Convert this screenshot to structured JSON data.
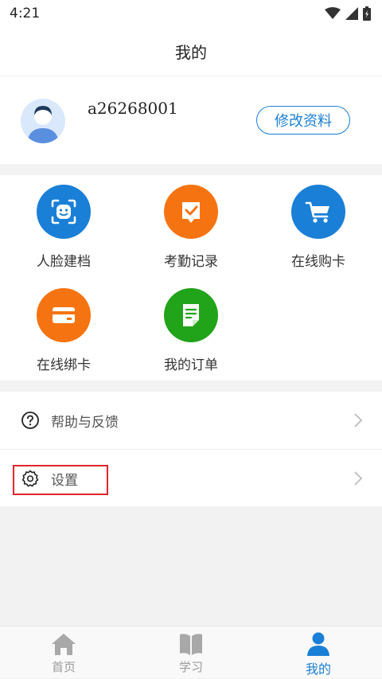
{
  "status": {
    "time": "4:21",
    "wifi_icon": "wifi-icon",
    "signal_icon": "signal-icon",
    "battery_icon": "battery-icon"
  },
  "header": {
    "title": "我的"
  },
  "profile": {
    "username": "a26268001",
    "edit_label": "修改资料",
    "avatar_icon": "avatar-icon"
  },
  "grid": {
    "items": [
      {
        "label": "人脸建档",
        "icon": "face-scan-icon",
        "color": "#1a7fd6"
      },
      {
        "label": "考勤记录",
        "icon": "attendance-icon",
        "color": "#f57411"
      },
      {
        "label": "在线购卡",
        "icon": "cart-icon",
        "color": "#1a7fd6"
      },
      {
        "label": "在线绑卡",
        "icon": "card-icon",
        "color": "#f57411"
      },
      {
        "label": "我的订单",
        "icon": "order-icon",
        "color": "#21a31a"
      }
    ]
  },
  "list": {
    "items": [
      {
        "label": "帮助与反馈",
        "icon": "help-icon"
      },
      {
        "label": "设置",
        "icon": "settings-icon"
      }
    ]
  },
  "tabbar": {
    "tabs": [
      {
        "label": "首页",
        "icon": "home-icon",
        "active": false
      },
      {
        "label": "学习",
        "icon": "book-icon",
        "active": false
      },
      {
        "label": "我的",
        "icon": "user-icon",
        "active": true
      }
    ]
  },
  "colors": {
    "accent": "#1a7fd6",
    "orange": "#f57411",
    "green": "#21a31a",
    "highlight": "#e0262b"
  }
}
